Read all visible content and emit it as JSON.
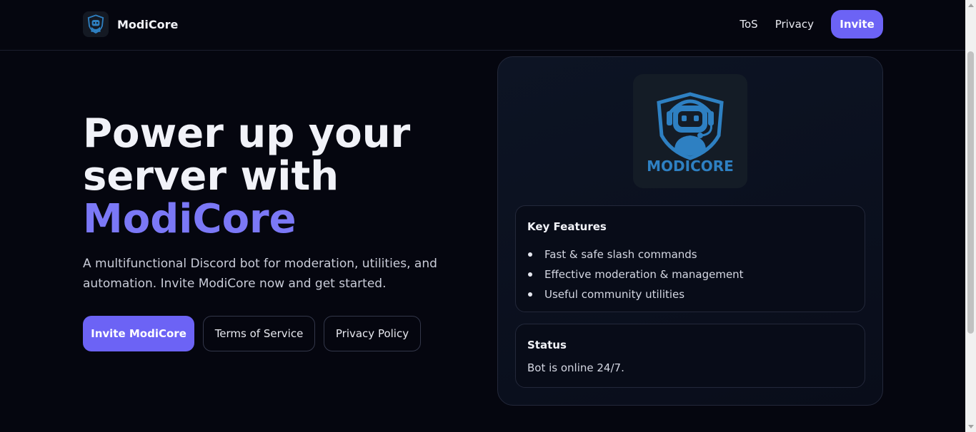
{
  "header": {
    "brand_name": "ModiCore",
    "nav": {
      "tos": "ToS",
      "privacy": "Privacy",
      "invite": "Invite"
    }
  },
  "hero": {
    "title_line1": "Power up your",
    "title_line2": "server with",
    "title_accent": "ModiCore",
    "subtitle": "A multifunctional Discord bot for moderation, utilities, and automation. Invite ModiCore now and get started.",
    "buttons": {
      "invite": "Invite ModiCore",
      "terms": "Terms of Service",
      "privacy": "Privacy Policy"
    }
  },
  "card": {
    "logo_text": "MODICORE",
    "features": {
      "heading": "Key Features",
      "items": [
        "Fast & safe slash commands",
        "Effective moderation & management",
        "Useful community utilities"
      ]
    },
    "status": {
      "heading": "Status",
      "text": "Bot is online 24/7."
    }
  },
  "colors": {
    "background": "#05060f",
    "accent": "#6c63f5",
    "accent_text": "#7b78f6",
    "logo_blue": "#2e80c2"
  },
  "icons": {
    "brand": "robot-shield-icon",
    "card_logo": "robot-shield-icon"
  }
}
